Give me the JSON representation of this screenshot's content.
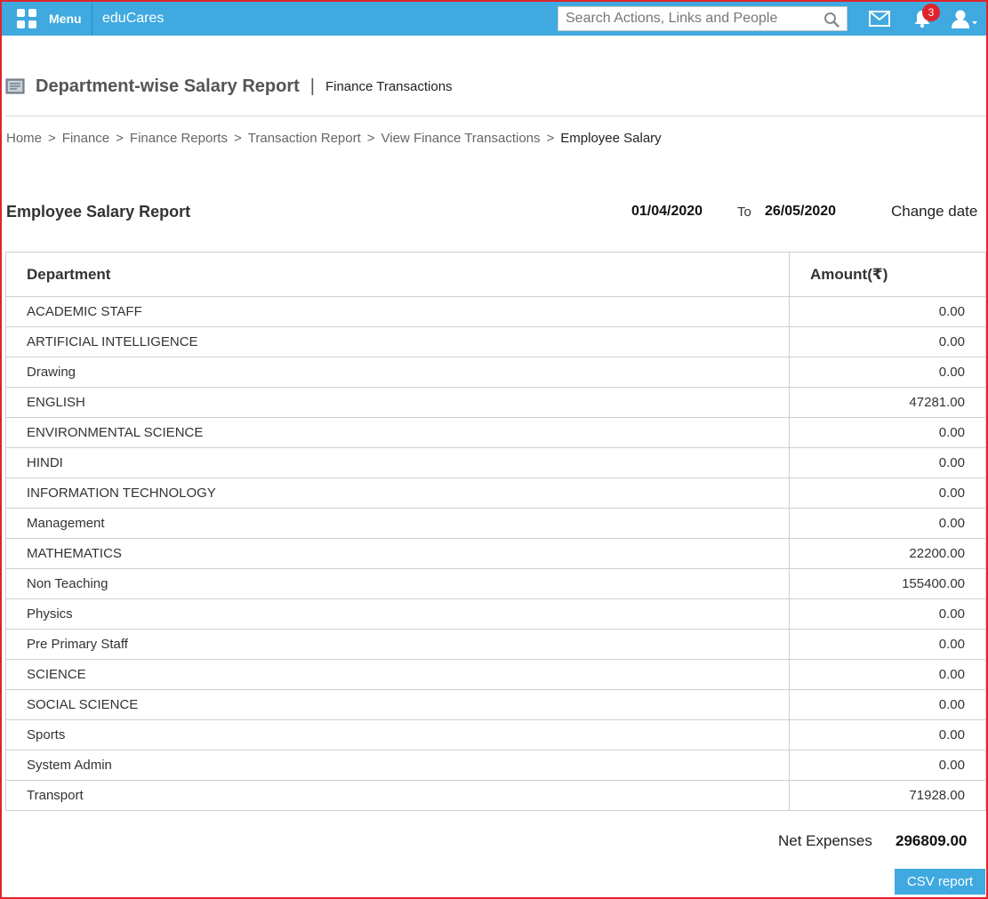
{
  "topbar": {
    "menu_label": "Menu",
    "brand": "eduCares",
    "search_placeholder": "Search Actions, Links and People",
    "notification_count": "3",
    "bar_color": "#3fa9e0"
  },
  "header": {
    "title": "Department-wise Salary Report",
    "separator": "|",
    "subtitle": "Finance Transactions"
  },
  "breadcrumb": {
    "items": [
      "Home",
      "Finance",
      "Finance Reports",
      "Transaction Report",
      "View Finance Transactions",
      "Employee Salary"
    ],
    "separator": ">"
  },
  "report": {
    "title": "Employee Salary Report",
    "date_from": "01/04/2020",
    "to_label": "To",
    "date_to": "26/05/2020",
    "change_date_label": "Change date"
  },
  "table": {
    "headers": {
      "department": "Department",
      "amount": "Amount(₹)"
    },
    "rows": [
      {
        "department": "ACADEMIC STAFF",
        "amount": "0.00"
      },
      {
        "department": "ARTIFICIAL INTELLIGENCE",
        "amount": "0.00"
      },
      {
        "department": "Drawing",
        "amount": "0.00"
      },
      {
        "department": "ENGLISH",
        "amount": "47281.00"
      },
      {
        "department": "ENVIRONMENTAL SCIENCE",
        "amount": "0.00"
      },
      {
        "department": "HINDI",
        "amount": "0.00"
      },
      {
        "department": "INFORMATION TECHNOLOGY",
        "amount": "0.00"
      },
      {
        "department": "Management",
        "amount": "0.00"
      },
      {
        "department": "MATHEMATICS",
        "amount": "22200.00"
      },
      {
        "department": "Non Teaching",
        "amount": "155400.00"
      },
      {
        "department": "Physics",
        "amount": "0.00"
      },
      {
        "department": "Pre Primary Staff",
        "amount": "0.00"
      },
      {
        "department": "SCIENCE",
        "amount": "0.00"
      },
      {
        "department": "SOCIAL SCIENCE",
        "amount": "0.00"
      },
      {
        "department": "Sports",
        "amount": "0.00"
      },
      {
        "department": "System Admin",
        "amount": "0.00"
      },
      {
        "department": "Transport",
        "amount": "71928.00"
      }
    ]
  },
  "summary": {
    "net_label": "Net Expenses",
    "net_value": "296809.00"
  },
  "actions": {
    "csv_label": "CSV report"
  },
  "icons": [
    "grid-icon",
    "search-icon",
    "mail-icon",
    "bell-icon",
    "user-icon",
    "report-icon"
  ]
}
